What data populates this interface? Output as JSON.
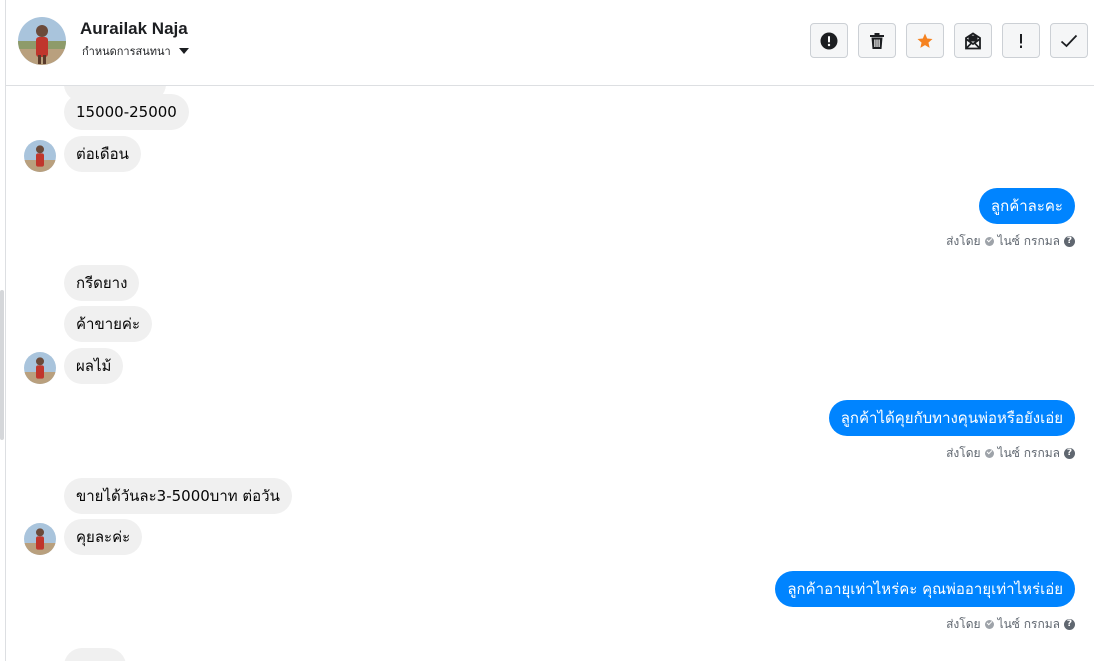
{
  "contact": {
    "name": "Aurailak Naja",
    "label_action": "กำหนดการสนทนา"
  },
  "toolbar": [
    {
      "name": "mark-spam-button",
      "icon": "exclamation-circle-icon"
    },
    {
      "name": "delete-button",
      "icon": "trash-icon"
    },
    {
      "name": "star-button",
      "icon": "star-icon",
      "color": "#f58220"
    },
    {
      "name": "mark-unread-button",
      "icon": "envelope-icon"
    },
    {
      "name": "important-button",
      "icon": "exclamation-icon"
    },
    {
      "name": "mark-done-button",
      "icon": "check-icon"
    }
  ],
  "messages": [
    {
      "side": "in",
      "text": "15000-25000"
    },
    {
      "side": "in",
      "text": "ต่อเดือน",
      "avatar": true
    },
    {
      "side": "out",
      "text": "ลูกค้าละคะ",
      "meta": "ส่งโดย",
      "sender": "ไนซ์ กรกมล"
    },
    {
      "side": "in",
      "text": "กรีดยาง"
    },
    {
      "side": "in",
      "text": "ค้าขายค่ะ"
    },
    {
      "side": "in",
      "text": "ผลไม้",
      "avatar": true
    },
    {
      "side": "out",
      "text": "ลูกค้าได้คุยกับทางคุนพ่อหรือยังเอ่ย",
      "meta": "ส่งโดย",
      "sender": "ไนซ์ กรกมล"
    },
    {
      "side": "in",
      "text": "ขายได้วันละ3-5000บาท ต่อวัน"
    },
    {
      "side": "in",
      "text": "คุยละค่ะ",
      "avatar": true
    },
    {
      "side": "out",
      "text": "ลูกค้าอายุเท่าไหร่คะ คุณพ่ออายุเท่าไหร่เอ่ย",
      "meta": "ส่งโดย",
      "sender": "ไนซ์ กรกมล"
    }
  ],
  "colors": {
    "outgoing": "#0084ff",
    "incoming": "#f0f0f0",
    "star": "#f58220"
  }
}
